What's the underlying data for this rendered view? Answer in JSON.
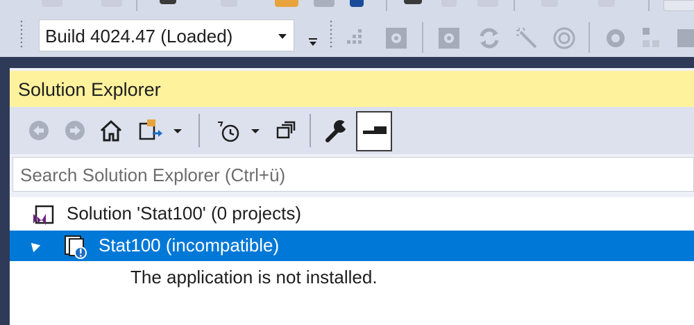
{
  "toolbar": {
    "build_dropdown": {
      "value": "Build 4024.47 (Loaded)"
    }
  },
  "solution_explorer": {
    "title": "Solution Explorer",
    "search": {
      "placeholder": "Search Solution Explorer (Ctrl+ü)"
    },
    "tree": {
      "solution_label": "Solution 'Stat100' (0 projects)",
      "project_label": "Stat100 (incompatible)",
      "project_message": "The application is not installed."
    }
  },
  "colors": {
    "title_bar": "#fff29d",
    "selection": "#0078d7",
    "dark_band": "#2e3a57",
    "toolbar_bg": "#d6dbe9"
  }
}
